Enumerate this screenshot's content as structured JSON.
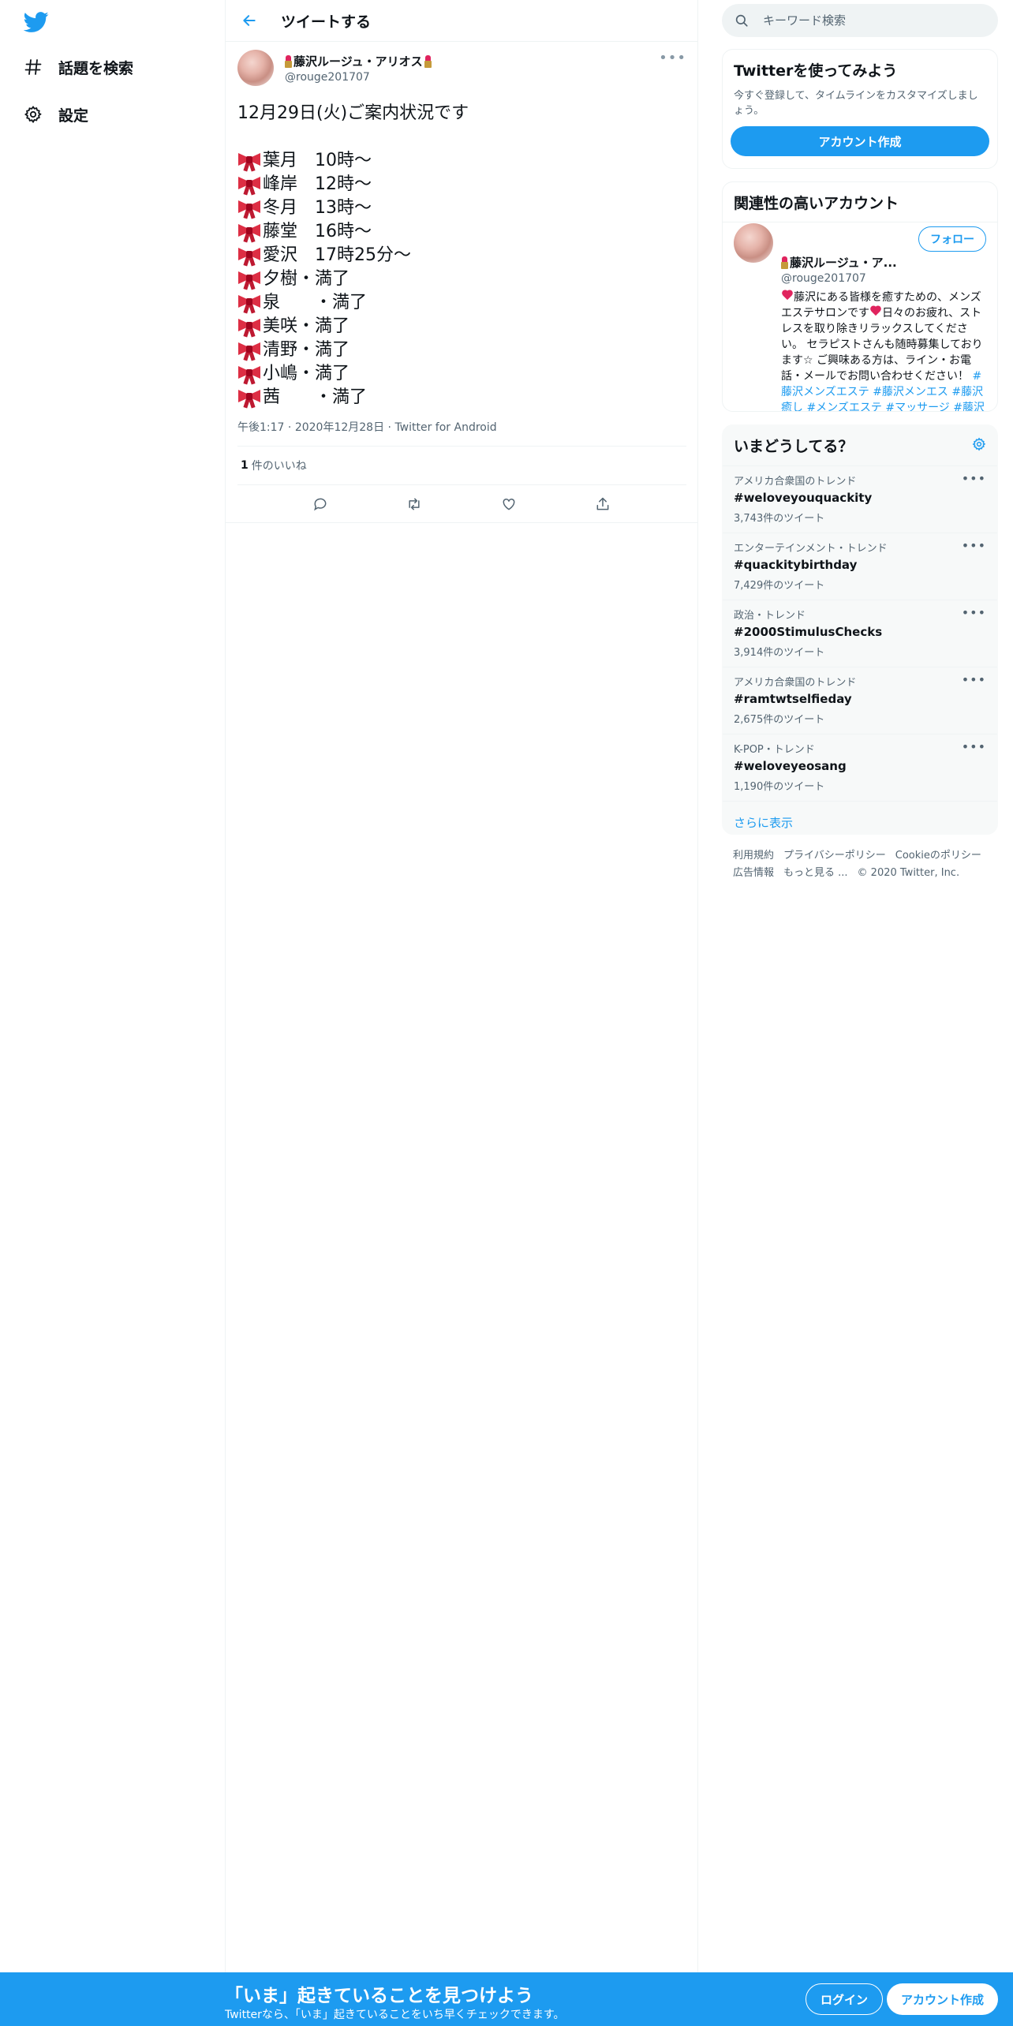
{
  "sidebar": {
    "items": [
      {
        "label": "話題を検索",
        "icon": "hashtag-icon"
      },
      {
        "label": "設定",
        "icon": "gear-icon"
      }
    ]
  },
  "header": {
    "title": "ツイートする"
  },
  "tweet": {
    "author_name": "藤沢ルージュ・アリオス",
    "author_handle": "@rouge201707",
    "lead": "12月29日(火)ご案内状況です",
    "schedule": [
      "葉月　10時～",
      "峰岸　12時～",
      "冬月　13時～",
      "藤堂　16時〜",
      "愛沢　17時25分～",
      "夕樹・満了",
      "泉　　・満了",
      "美咲・満了",
      "清野・満了",
      "小嶋・満了",
      "茜　　・満了"
    ],
    "time": "午後1:17",
    "date": "2020年12月28日",
    "source": "Twitter for Android",
    "likes_count": "1",
    "likes_label": "件のいいね"
  },
  "search": {
    "placeholder": "キーワード検索"
  },
  "signup_card": {
    "title": "Twitterを使ってみよう",
    "desc": "今すぐ登録して、タイムラインをカスタマイズしましょう。",
    "button": "アカウント作成"
  },
  "related": {
    "title": "関連性の高いアカウント",
    "name": "藤沢ルージュ・ア...",
    "handle": "@rouge201707",
    "follow": "フォロー",
    "bio_1": "藤沢にある皆様を癒すための、メンズエステサロンです",
    "bio_2": "日々のお疲れ、ストレスを取り除きリラックスしてください。 セラピストさんも随時募集しております☆ ご興味ある方は、ライン・お電話・メールでお問い合わせください！ ",
    "tags": [
      "#藤沢メンズエステ",
      "#藤沢メンエス",
      "#藤沢癒し",
      "#メンズエステ",
      "#マッサージ",
      "#藤沢"
    ]
  },
  "trends": {
    "title": "いまどうしてる？",
    "items": [
      {
        "context": "アメリカ合衆国のトレンド",
        "tag": "#weloveyouquackity",
        "count": "3,743件のツイート"
      },
      {
        "context": "エンターテインメント・トレンド",
        "tag": "#quackitybirthday",
        "count": "7,429件のツイート"
      },
      {
        "context": "政治・トレンド",
        "tag": "#2000StimulusChecks",
        "count": "3,914件のツイート"
      },
      {
        "context": "アメリカ合衆国のトレンド",
        "tag": "#ramtwtselfieday",
        "count": "2,675件のツイート"
      },
      {
        "context": "K-POP・トレンド",
        "tag": "#weloveyeosang",
        "count": "1,190件のツイート"
      }
    ],
    "show_more": "さらに表示"
  },
  "footer": {
    "links": [
      "利用規約",
      "プライバシーポリシー",
      "Cookieのポリシー",
      "広告情報",
      "もっと見る ..."
    ],
    "copyright": "© 2020 Twitter, Inc."
  },
  "bottom_bar": {
    "title": "「いま」起きていることを見つけよう",
    "subtitle": "Twitterなら、「いま」起きていることをいち早くチェックできます。",
    "login": "ログイン",
    "signup": "アカウント作成"
  },
  "colors": {
    "accent": "#1d9bf0",
    "text": "#0f1419",
    "muted": "#536471",
    "border": "#eff3f4"
  }
}
